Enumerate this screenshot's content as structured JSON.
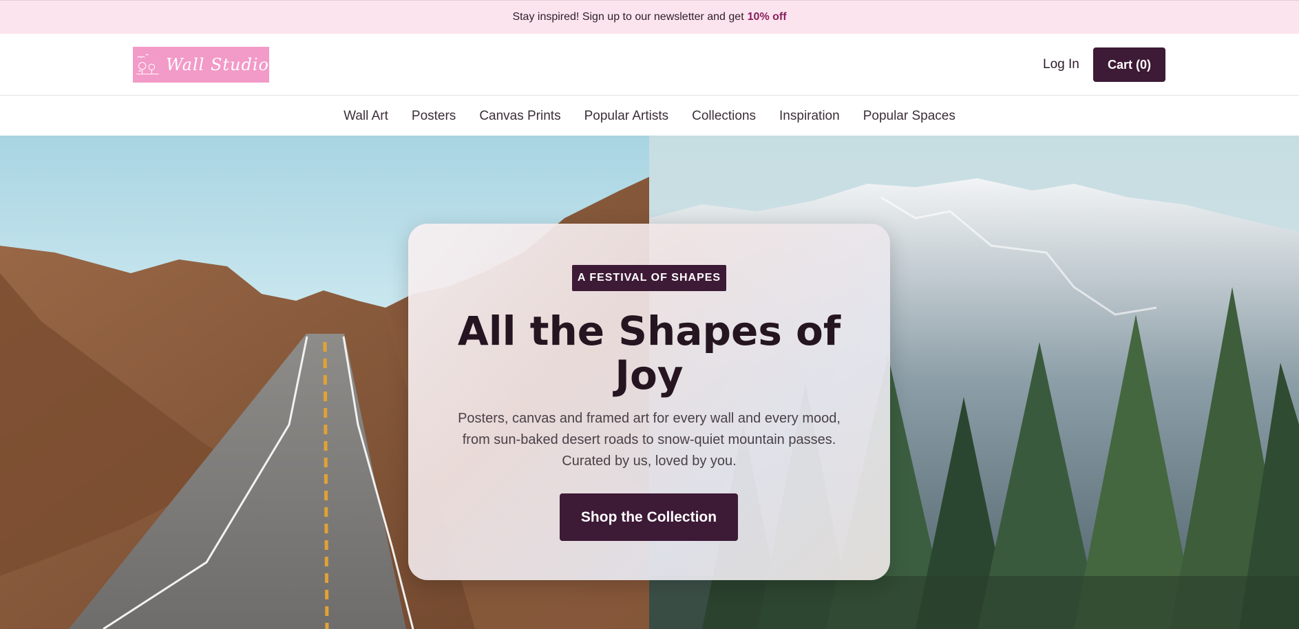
{
  "announcement": {
    "text": "Stay inspired! Sign up to our newsletter and get",
    "promo": "10% off"
  },
  "header": {
    "logo_text": "Wall Studio",
    "login_label": "Log In",
    "cart_label": "Cart (0)"
  },
  "nav": {
    "items": [
      "Wall Art",
      "Posters",
      "Canvas Prints",
      "Popular Artists",
      "Collections",
      "Inspiration",
      "Popular Spaces"
    ]
  },
  "hero": {
    "badge": "A FESTIVAL OF SHAPES",
    "headline": "All the Shapes of Joy",
    "subtext": "Posters, canvas and framed art for every wall and every mood, from sun-baked desert roads to snow-quiet mountain passes. Curated by us, loved by you.",
    "cta_label": "Shop the Collection",
    "left_image": "desert-road-photo",
    "right_image": "snowy-mountain-forest-photo"
  },
  "colors": {
    "brand": "#3d1a36",
    "announce_bg": "#fce4ef",
    "promo": "#8a1f5c",
    "logo_bg": "#f29ac8"
  }
}
